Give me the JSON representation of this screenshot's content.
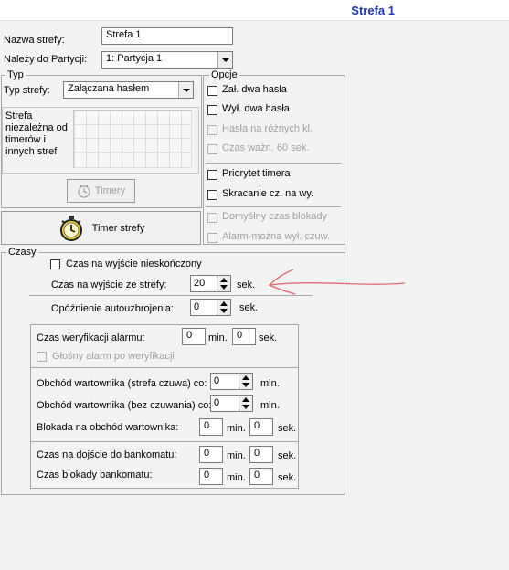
{
  "header": {
    "title": "Strefa 1"
  },
  "fields": {
    "zone_name_label": "Nazwa strefy:",
    "zone_name_value": "Strefa  1",
    "partition_label": "Należy do Partycji:",
    "partition_value": "1: Partycja 1"
  },
  "typ": {
    "legend": "Typ",
    "type_label": "Typ strefy:",
    "type_value": "Załączana hasłem",
    "independent_text": "Strefa niezależna od timerów i innych stref",
    "timers_button": "Timery",
    "timer_zone_button": "Timer strefy"
  },
  "opcje": {
    "legend": "Opcje",
    "items": [
      {
        "label": "Zał. dwa hasła",
        "disabled": false
      },
      {
        "label": "Wył. dwa hasła",
        "disabled": false
      },
      {
        "label": "Hasła na różnych kl.",
        "disabled": true
      },
      {
        "label": "Czas ważn. 60 sek.",
        "disabled": true
      },
      {
        "label": "Priorytet timera",
        "disabled": false
      },
      {
        "label": "Skracanie cz. na wy.",
        "disabled": false
      },
      {
        "label": "Domyślny czas blokady",
        "disabled": true
      },
      {
        "label": "Alarm-można wył. czuw.",
        "disabled": true
      }
    ]
  },
  "czasy": {
    "legend": "Czasy",
    "exit_infinite": "Czas na wyjście nieskończony",
    "exit_time_label": "Czas na wyjście ze strefy:",
    "exit_time_value": "20",
    "sek": "sek.",
    "min": "min.",
    "autoarm_label": "Opóźnienie autouzbrojenia:",
    "autoarm_value": "0",
    "verify_label": "Czas weryfikacji alarmu:",
    "verify_min": "0",
    "verify_sec": "0",
    "loud_alarm": "Głośny alarm po weryfikacji",
    "guard_armed_label": "Obchód wartownika (strefa czuwa) co:",
    "guard_armed_value": "0",
    "guard_unarmed_label": "Obchód wartownika (bez czuwania) co:",
    "guard_unarmed_value": "0",
    "guard_block_label": "Blokada na obchód wartownika:",
    "guard_block_min": "0",
    "guard_block_sec": "0",
    "atm_access_label": "Czas na dojście do bankomatu:",
    "atm_access_min": "0",
    "atm_access_sec": "0",
    "atm_block_label": "Czas blokady bankomatu:",
    "atm_block_min": "0",
    "atm_block_sec": "0"
  },
  "colors": {
    "title": "#1f3aa8",
    "annotation_arrow": "#e06a72"
  }
}
